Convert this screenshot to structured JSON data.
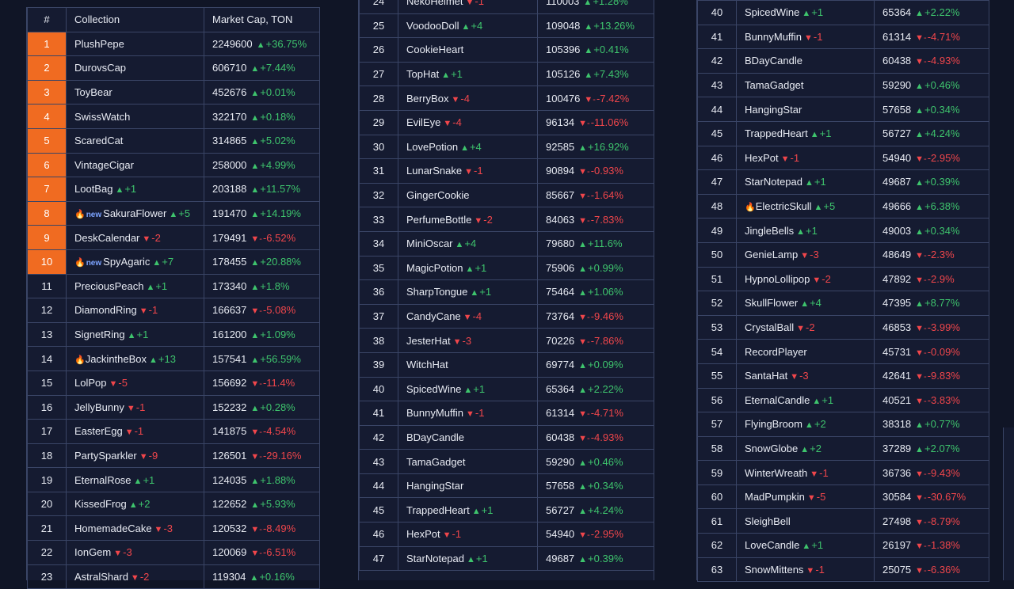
{
  "header": {
    "rank": "#",
    "collection": "Collection",
    "market_cap": "Market Cap, TON"
  },
  "panels": [
    {
      "rows": [
        {
          "rank": "1",
          "name": "PlushPepe",
          "change": "",
          "cap": "2249600",
          "pct": "+36.75%",
          "top": true
        },
        {
          "rank": "2",
          "name": "DurovsCap",
          "change": "",
          "cap": "606710",
          "pct": "+7.44%",
          "top": true
        },
        {
          "rank": "3",
          "name": "ToyBear",
          "change": "",
          "cap": "452676",
          "pct": "+0.01%",
          "top": true
        },
        {
          "rank": "4",
          "name": "SwissWatch",
          "change": "",
          "cap": "322170",
          "pct": "+0.18%",
          "top": true
        },
        {
          "rank": "5",
          "name": "ScaredCat",
          "change": "",
          "cap": "314865",
          "pct": "+5.02%",
          "top": true
        },
        {
          "rank": "6",
          "name": "VintageCigar",
          "change": "",
          "cap": "258000",
          "pct": "+4.99%",
          "top": true
        },
        {
          "rank": "7",
          "name": "LootBag",
          "change": "+1",
          "cap": "203188",
          "pct": "+11.57%",
          "top": true
        },
        {
          "rank": "8",
          "name": "SakuraFlower",
          "change": "+5",
          "cap": "191470",
          "pct": "+14.19%",
          "top": true,
          "fire": true,
          "new": "new"
        },
        {
          "rank": "9",
          "name": "DeskCalendar",
          "change": "-2",
          "cap": "179491",
          "pct": "-6.52%",
          "top": true
        },
        {
          "rank": "10",
          "name": "SpyAgaric",
          "change": "+7",
          "cap": "178455",
          "pct": "+20.88%",
          "top": true,
          "fire": true,
          "new": "new"
        },
        {
          "rank": "11",
          "name": "PreciousPeach",
          "change": "+1",
          "cap": "173340",
          "pct": "+1.8%"
        },
        {
          "rank": "12",
          "name": "DiamondRing",
          "change": "-1",
          "cap": "166637",
          "pct": "-5.08%"
        },
        {
          "rank": "13",
          "name": "SignetRing",
          "change": "+1",
          "cap": "161200",
          "pct": "+1.09%"
        },
        {
          "rank": "14",
          "name": "JackintheBox",
          "change": "+13",
          "cap": "157541",
          "pct": "+56.59%",
          "fire": true
        },
        {
          "rank": "15",
          "name": "LolPop",
          "change": "-5",
          "cap": "156692",
          "pct": "-11.4%"
        },
        {
          "rank": "16",
          "name": "JellyBunny",
          "change": "-1",
          "cap": "152232",
          "pct": "+0.28%"
        },
        {
          "rank": "17",
          "name": "EasterEgg",
          "change": "-1",
          "cap": "141875",
          "pct": "-4.54%"
        },
        {
          "rank": "18",
          "name": "PartySparkler",
          "change": "-9",
          "cap": "126501",
          "pct": "-29.16%"
        },
        {
          "rank": "19",
          "name": "EternalRose",
          "change": "+1",
          "cap": "124035",
          "pct": "+1.88%"
        },
        {
          "rank": "20",
          "name": "KissedFrog",
          "change": "+2",
          "cap": "122652",
          "pct": "+5.93%"
        },
        {
          "rank": "21",
          "name": "HomemadeCake",
          "change": "-3",
          "cap": "120532",
          "pct": "-8.49%"
        },
        {
          "rank": "22",
          "name": "IonGem",
          "change": "-3",
          "cap": "120069",
          "pct": "-6.51%"
        },
        {
          "rank": "23",
          "name": "AstralShard",
          "change": "-2",
          "cap": "119304",
          "pct": "+0.16%"
        }
      ]
    },
    {
      "rows": [
        {
          "rank": "24",
          "name": "NekoHelmet",
          "change": "-1",
          "cap": "110003",
          "pct": "+1.28%"
        },
        {
          "rank": "25",
          "name": "VoodooDoll",
          "change": "+4",
          "cap": "109048",
          "pct": "+13.26%"
        },
        {
          "rank": "26",
          "name": "CookieHeart",
          "change": "",
          "cap": "105396",
          "pct": "+0.41%"
        },
        {
          "rank": "27",
          "name": "TopHat",
          "change": "+1",
          "cap": "105126",
          "pct": "+7.43%"
        },
        {
          "rank": "28",
          "name": "BerryBox",
          "change": "-4",
          "cap": "100476",
          "pct": "-7.42%"
        },
        {
          "rank": "29",
          "name": "EvilEye",
          "change": "-4",
          "cap": "96134",
          "pct": "-11.06%"
        },
        {
          "rank": "30",
          "name": "LovePotion",
          "change": "+4",
          "cap": "92585",
          "pct": "+16.92%"
        },
        {
          "rank": "31",
          "name": "LunarSnake",
          "change": "-1",
          "cap": "90894",
          "pct": "-0.93%"
        },
        {
          "rank": "32",
          "name": "GingerCookie",
          "change": "",
          "cap": "85667",
          "pct": "-1.64%"
        },
        {
          "rank": "33",
          "name": "PerfumeBottle",
          "change": "-2",
          "cap": "84063",
          "pct": "-7.83%"
        },
        {
          "rank": "34",
          "name": "MiniOscar",
          "change": "+4",
          "cap": "79680",
          "pct": "+11.6%"
        },
        {
          "rank": "35",
          "name": "MagicPotion",
          "change": "+1",
          "cap": "75906",
          "pct": "+0.99%"
        },
        {
          "rank": "36",
          "name": "SharpTongue",
          "change": "+1",
          "cap": "75464",
          "pct": "+1.06%"
        },
        {
          "rank": "37",
          "name": "CandyCane",
          "change": "-4",
          "cap": "73764",
          "pct": "-9.46%"
        },
        {
          "rank": "38",
          "name": "JesterHat",
          "change": "-3",
          "cap": "70226",
          "pct": "-7.86%"
        },
        {
          "rank": "39",
          "name": "WitchHat",
          "change": "",
          "cap": "69774",
          "pct": "+0.09%"
        },
        {
          "rank": "40",
          "name": "SpicedWine",
          "change": "+1",
          "cap": "65364",
          "pct": "+2.22%"
        },
        {
          "rank": "41",
          "name": "BunnyMuffin",
          "change": "-1",
          "cap": "61314",
          "pct": "-4.71%"
        },
        {
          "rank": "42",
          "name": "BDayCandle",
          "change": "",
          "cap": "60438",
          "pct": "-4.93%"
        },
        {
          "rank": "43",
          "name": "TamaGadget",
          "change": "",
          "cap": "59290",
          "pct": "+0.46%"
        },
        {
          "rank": "44",
          "name": "HangingStar",
          "change": "",
          "cap": "57658",
          "pct": "+0.34%"
        },
        {
          "rank": "45",
          "name": "TrappedHeart",
          "change": "+1",
          "cap": "56727",
          "pct": "+4.24%"
        },
        {
          "rank": "46",
          "name": "HexPot",
          "change": "-1",
          "cap": "54940",
          "pct": "-2.95%"
        },
        {
          "rank": "47",
          "name": "StarNotepad",
          "change": "+1",
          "cap": "49687",
          "pct": "+0.39%"
        }
      ]
    },
    {
      "rows": [
        {
          "rank": "40",
          "name": "SpicedWine",
          "change": "+1",
          "cap": "65364",
          "pct": "+2.22%"
        },
        {
          "rank": "41",
          "name": "BunnyMuffin",
          "change": "-1",
          "cap": "61314",
          "pct": "-4.71%"
        },
        {
          "rank": "42",
          "name": "BDayCandle",
          "change": "",
          "cap": "60438",
          "pct": "-4.93%"
        },
        {
          "rank": "43",
          "name": "TamaGadget",
          "change": "",
          "cap": "59290",
          "pct": "+0.46%"
        },
        {
          "rank": "44",
          "name": "HangingStar",
          "change": "",
          "cap": "57658",
          "pct": "+0.34%"
        },
        {
          "rank": "45",
          "name": "TrappedHeart",
          "change": "+1",
          "cap": "56727",
          "pct": "+4.24%"
        },
        {
          "rank": "46",
          "name": "HexPot",
          "change": "-1",
          "cap": "54940",
          "pct": "-2.95%"
        },
        {
          "rank": "47",
          "name": "StarNotepad",
          "change": "+1",
          "cap": "49687",
          "pct": "+0.39%"
        },
        {
          "rank": "48",
          "name": "ElectricSkull",
          "change": "+5",
          "cap": "49666",
          "pct": "+6.38%",
          "fire": true
        },
        {
          "rank": "49",
          "name": "JingleBells",
          "change": "+1",
          "cap": "49003",
          "pct": "+0.34%"
        },
        {
          "rank": "50",
          "name": "GenieLamp",
          "change": "-3",
          "cap": "48649",
          "pct": "-2.3%"
        },
        {
          "rank": "51",
          "name": "HypnoLollipop",
          "change": "-2",
          "cap": "47892",
          "pct": "-2.9%"
        },
        {
          "rank": "52",
          "name": "SkullFlower",
          "change": "+4",
          "cap": "47395",
          "pct": "+8.77%"
        },
        {
          "rank": "53",
          "name": "CrystalBall",
          "change": "-2",
          "cap": "46853",
          "pct": "-3.99%"
        },
        {
          "rank": "54",
          "name": "RecordPlayer",
          "change": "",
          "cap": "45731",
          "pct": "-0.09%"
        },
        {
          "rank": "55",
          "name": "SantaHat",
          "change": "-3",
          "cap": "42641",
          "pct": "-9.83%"
        },
        {
          "rank": "56",
          "name": "EternalCandle",
          "change": "+1",
          "cap": "40521",
          "pct": "-3.83%"
        },
        {
          "rank": "57",
          "name": "FlyingBroom",
          "change": "+2",
          "cap": "38318",
          "pct": "+0.77%"
        },
        {
          "rank": "58",
          "name": "SnowGlobe",
          "change": "+2",
          "cap": "37289",
          "pct": "+2.07%"
        },
        {
          "rank": "59",
          "name": "WinterWreath",
          "change": "-1",
          "cap": "36736",
          "pct": "-9.43%"
        },
        {
          "rank": "60",
          "name": "MadPumpkin",
          "change": "-5",
          "cap": "30584",
          "pct": "-30.67%"
        },
        {
          "rank": "61",
          "name": "SleighBell",
          "change": "",
          "cap": "27498",
          "pct": "-8.79%"
        },
        {
          "rank": "62",
          "name": "LoveCandle",
          "change": "+1",
          "cap": "26197",
          "pct": "-1.38%"
        },
        {
          "rank": "63",
          "name": "SnowMittens",
          "change": "-1",
          "cap": "25075",
          "pct": "-6.36%"
        }
      ]
    }
  ],
  "colors": {
    "up": "#3ec46d",
    "down": "#f0464b",
    "top_rank_bg": "#f06b21",
    "new_badge": "#7ca3ff"
  },
  "icons": {
    "up": "triangle-up-icon",
    "down": "triangle-down-icon",
    "fire": "fire-icon"
  }
}
